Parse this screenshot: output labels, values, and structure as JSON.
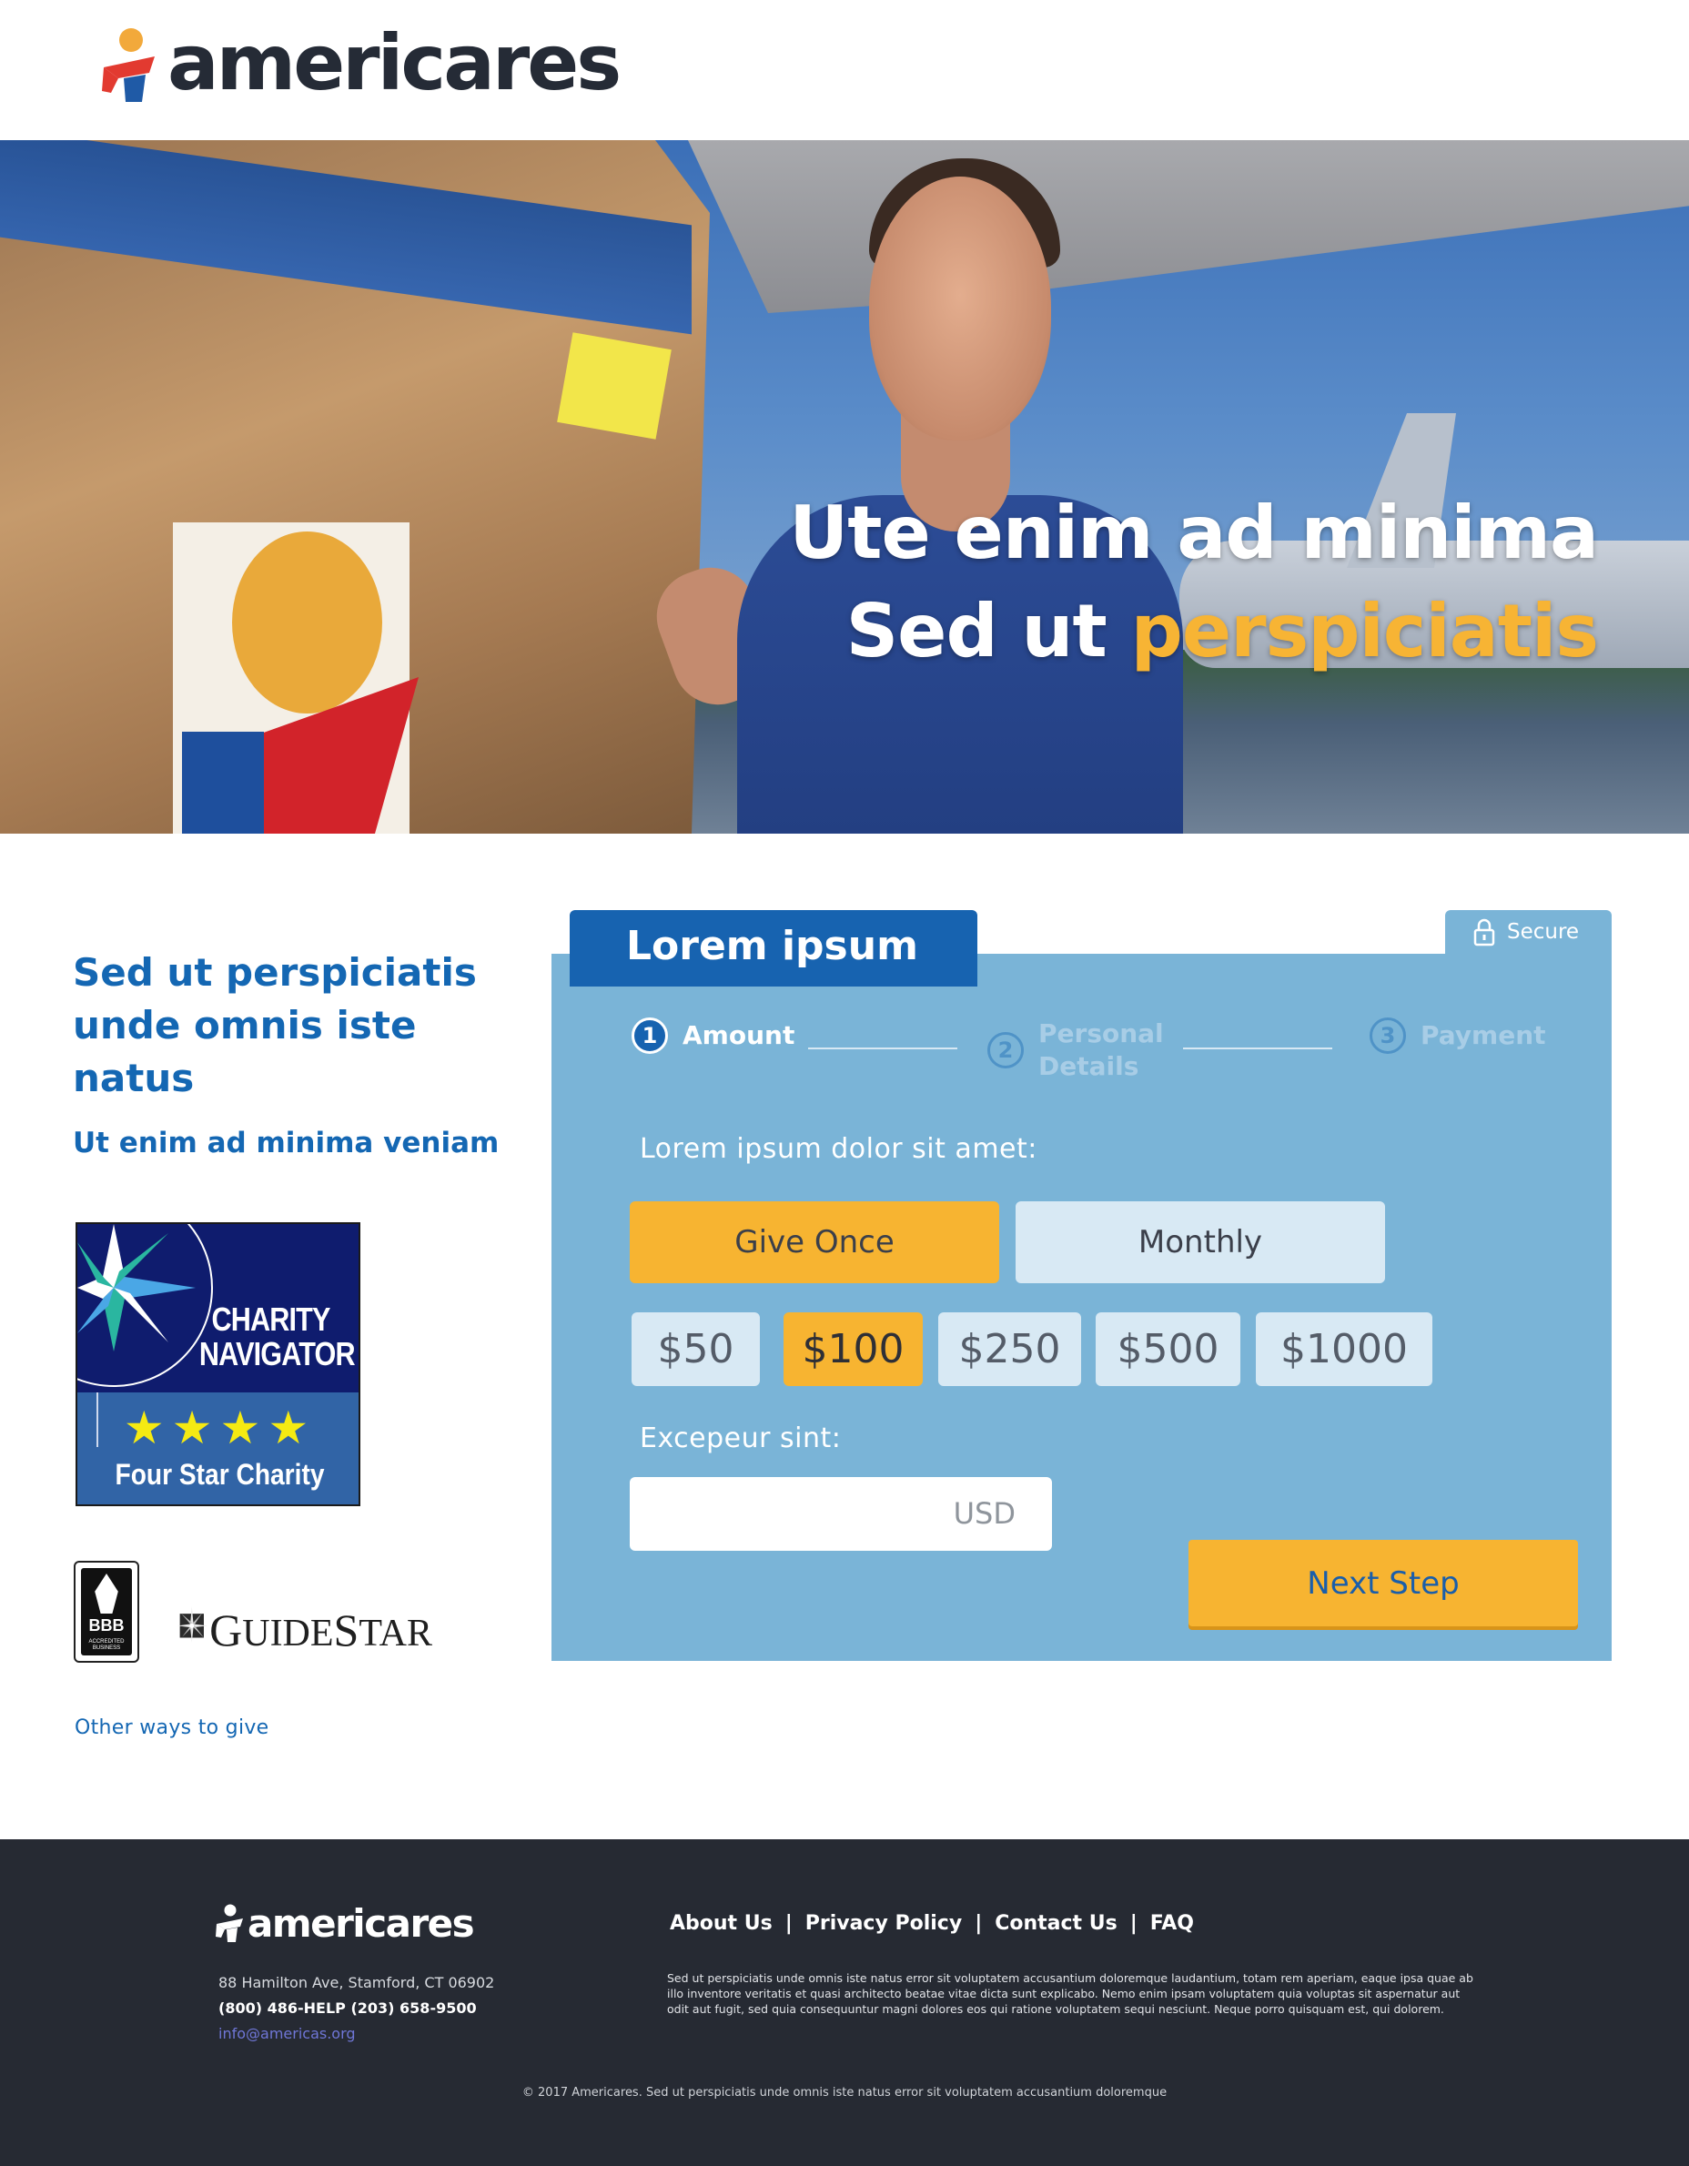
{
  "header": {
    "logo_text": "americares",
    "logo_icon": "americares-person-icon"
  },
  "hero": {
    "title_line1": "Ute enim ad minima",
    "title_line2_plain": "Sed ut ",
    "title_line2_accent": "perspiciatis",
    "accent_color": "#f7b434"
  },
  "sidebar": {
    "heading": "Sed ut perspiciatis unde omnis iste natus",
    "subheading": "Ut enim ad minima veniam",
    "charity_navigator": {
      "title_line1": "CHARITY",
      "title_line2": "NAVIGATOR",
      "stars": "★★★★",
      "rating": "Four Star Charity"
    },
    "bbb": {
      "label": "BBB",
      "small": "ACCREDITED BUSINESS"
    },
    "guidestar": {
      "first": "G",
      "mid": "UIDE",
      "second": "S",
      "last": "TAR"
    },
    "other_ways_link": "Other ways to give"
  },
  "donation": {
    "tab_label": "Lorem ipsum",
    "secure_label": "Secure",
    "steps": [
      {
        "number": "1",
        "label": "Amount",
        "active": true
      },
      {
        "number": "2",
        "label": "Personal Details",
        "active": false
      },
      {
        "number": "3",
        "label": "Payment",
        "active": false
      }
    ],
    "frequency_label": "Lorem ipsum dolor sit amet:",
    "frequency_options": [
      {
        "label": "Give Once",
        "selected": true
      },
      {
        "label": "Monthly",
        "selected": false
      }
    ],
    "amounts": [
      {
        "label": "$50",
        "selected": false
      },
      {
        "label": "$100",
        "selected": true
      },
      {
        "label": "$250",
        "selected": false
      },
      {
        "label": "$500",
        "selected": false
      },
      {
        "label": "$1000",
        "selected": false
      }
    ],
    "custom_label": "Excepeur sint:",
    "custom_value": "",
    "currency": "USD",
    "next_button": "Next Step",
    "colors": {
      "panel": "#7ab4d7",
      "tab": "#1763b0",
      "selected": "#f7b431",
      "unselected": "#d8e9f4"
    }
  },
  "footer": {
    "logo_text": "americares",
    "address": "88 Hamilton Ave, Stamford, CT 06902",
    "phone": "(800) 486-HELP  (203) 658-9500",
    "email": "info@americas.org",
    "nav": [
      "About Us",
      "Privacy Policy",
      "Contact Us",
      "FAQ"
    ],
    "body": "Sed ut perspiciatis unde omnis iste natus error sit voluptatem accusantium doloremque laudantium, totam rem aperiam, eaque ipsa quae ab illo inventore veritatis et quasi architecto beatae vitae dicta sunt explicabo. Nemo enim ipsam voluptatem quia voluptas sit aspernatur aut odit aut fugit, sed quia consequuntur magni dolores eos qui ratione voluptatem sequi nesciunt. Neque porro quisquam est, qui dolorem.",
    "copyright": "© 2017 Americares. Sed ut perspiciatis unde omnis iste natus error sit voluptatem accusantium doloremque",
    "background": "#262a33"
  }
}
